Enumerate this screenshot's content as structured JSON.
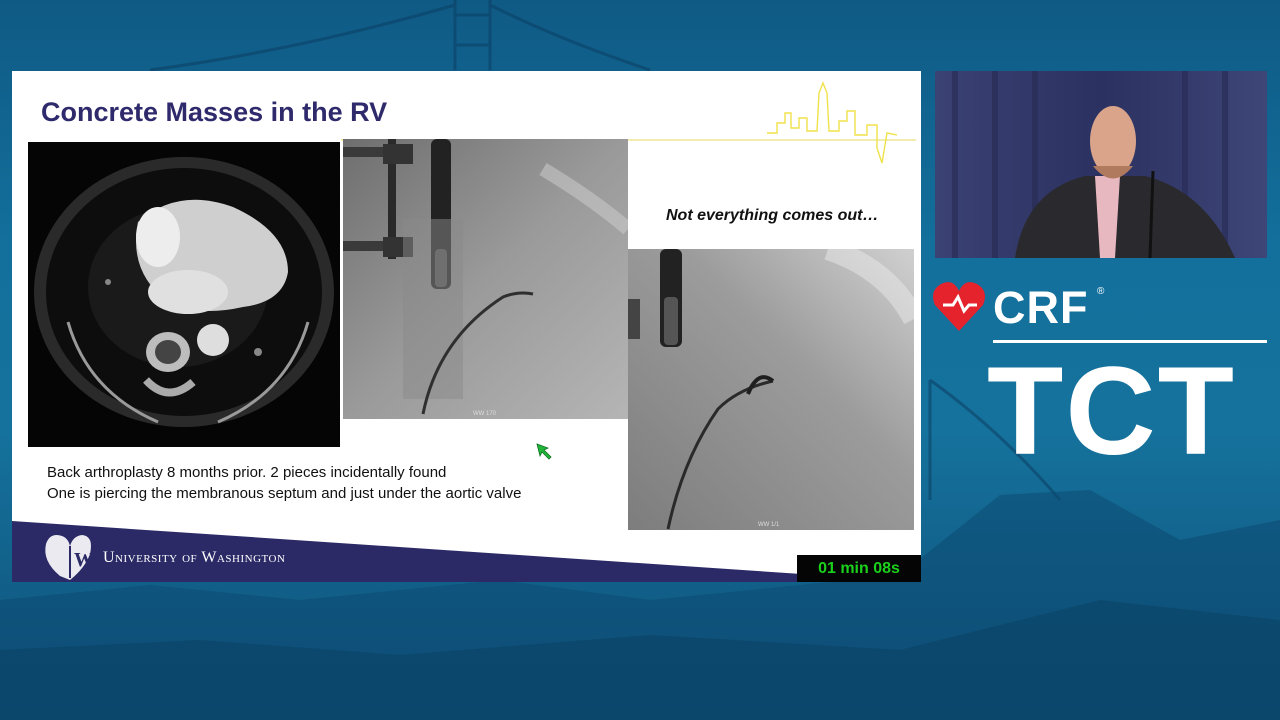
{
  "slide": {
    "title": "Concrete Masses in the RV",
    "caption": "Not everything comes out…",
    "body_line_1": "Back arthroplasty 8 months prior. 2 pieces incidentally found",
    "body_line_2": "One is piercing the membranous septum and just under the aortic valve",
    "fluoro1_label": "WW 170",
    "fluoro2_label": "WW 1/1",
    "footer_org": "University of Washington",
    "timer": "01 min 08s"
  },
  "brand": {
    "crf": "CRF",
    "registered": "®",
    "tct": "TCT"
  },
  "colors": {
    "title": "#2e2a6b",
    "footer_band": "#2b2a67",
    "timer_text": "#1bd11b",
    "crf_red": "#e4232d",
    "background_blue": "#13709c"
  },
  "icons": {
    "cursor": "green-arrow-cursor",
    "heart": "crf-heart-icon",
    "uw": "uw-heart-logo"
  }
}
